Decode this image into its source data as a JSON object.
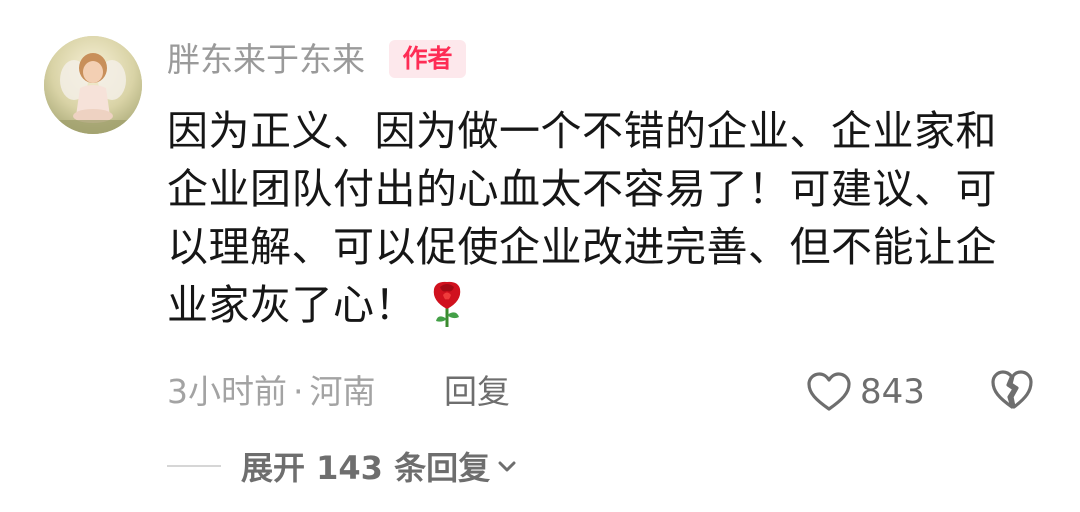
{
  "comment": {
    "username": "胖东来于东来",
    "author_badge": "作者",
    "text": "因为正义、因为做一个不错的企业、企业家和企业团队付出的心血太不容易了！可建议、可以理解、可以促使企业改进完善、但不能让企业家灰了心！",
    "time": "3小时前",
    "separator": "·",
    "location": "河南",
    "reply_label": "回复",
    "like_count": "843",
    "expand_label": "展开 143 条回复",
    "icons": {
      "emoji": "rose-icon",
      "like": "heart-icon",
      "dislike": "broken-heart-icon",
      "expand": "chevron-down-icon"
    },
    "colors": {
      "badge_text": "#fe2c55",
      "badge_bg": "#fde8ec",
      "rose": "#d0111e"
    }
  }
}
